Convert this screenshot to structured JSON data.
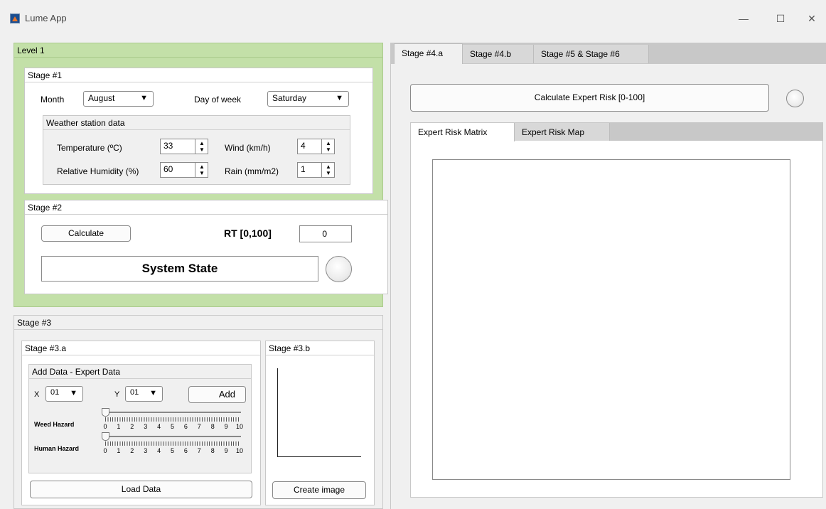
{
  "window": {
    "title": "Lume App",
    "minimize": "—",
    "maximize": "☐",
    "close": "✕"
  },
  "level1": {
    "title": "Level 1"
  },
  "stage1": {
    "title": "Stage #1",
    "month_label": "Month",
    "month_value": "August",
    "dow_label": "Day of week",
    "dow_value": "Saturday",
    "weather_title": "Weather station data",
    "temp_label": "Temperature (ºC)",
    "temp_value": "33",
    "wind_label": "Wind (km/h)",
    "wind_value": "4",
    "humidity_label": "Relative Humidity (%)",
    "humidity_value": "60",
    "rain_label": "Rain (mm/m2)",
    "rain_value": "1"
  },
  "stage2": {
    "title": "Stage #2",
    "calculate_label": "Calculate",
    "rt_label": "RT [0,100]",
    "rt_value": "0",
    "system_state_label": "System State"
  },
  "stage3": {
    "title": "Stage #3",
    "a_title": "Stage #3.a",
    "add_data_title": "Add Data - Expert Data",
    "x_label": "X",
    "x_value": "01",
    "y_label": "Y",
    "y_value": "01",
    "add_label": "Add",
    "weed_label": "Weed Hazard",
    "human_label": "Human Hazard",
    "weed_value": 0,
    "human_value": 0,
    "slider_ticks": [
      "0",
      "1",
      "2",
      "3",
      "4",
      "5",
      "6",
      "7",
      "8",
      "9",
      "10"
    ],
    "load_data_label": "Load Data",
    "b_title": "Stage #3.b",
    "create_image_label": "Create image"
  },
  "stage4": {
    "tabs": [
      "Stage #4.a",
      "Stage #4.b",
      "Stage #5 & Stage #6"
    ],
    "calc_expert_label": "Calculate Expert Risk [0-100]",
    "subtabs": [
      "Expert Risk Matrix",
      "Expert Risk Map"
    ]
  }
}
